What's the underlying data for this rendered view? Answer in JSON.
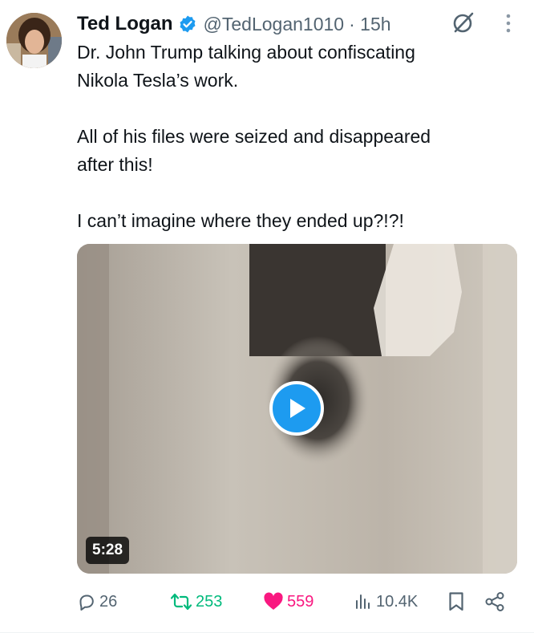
{
  "tweet": {
    "author_name": "Ted Logan",
    "handle": "@TedLogan1010",
    "time": "· 15h",
    "text_lines": [
      "Dr. John Trump talking about confiscating",
      "Nikola Tesla’s work.",
      "",
      "All of his files were seized and disappeared",
      "after this!",
      "",
      "I can’t imagine where they ended up?!?!"
    ],
    "video": {
      "duration": "5:28"
    }
  },
  "actions": {
    "replies": "26",
    "reposts": "253",
    "likes": "559",
    "views": "10.4K"
  },
  "colors": {
    "text": "#0f1419",
    "secondary": "#536471",
    "accent": "#1d9bf0",
    "repost": "#00ba7c",
    "like": "#f91880"
  },
  "icons": [
    "verified-badge-icon",
    "grok-icon",
    "more-icon",
    "play-icon",
    "reply-icon",
    "repost-icon",
    "like-icon",
    "views-icon",
    "bookmark-icon",
    "share-icon"
  ]
}
